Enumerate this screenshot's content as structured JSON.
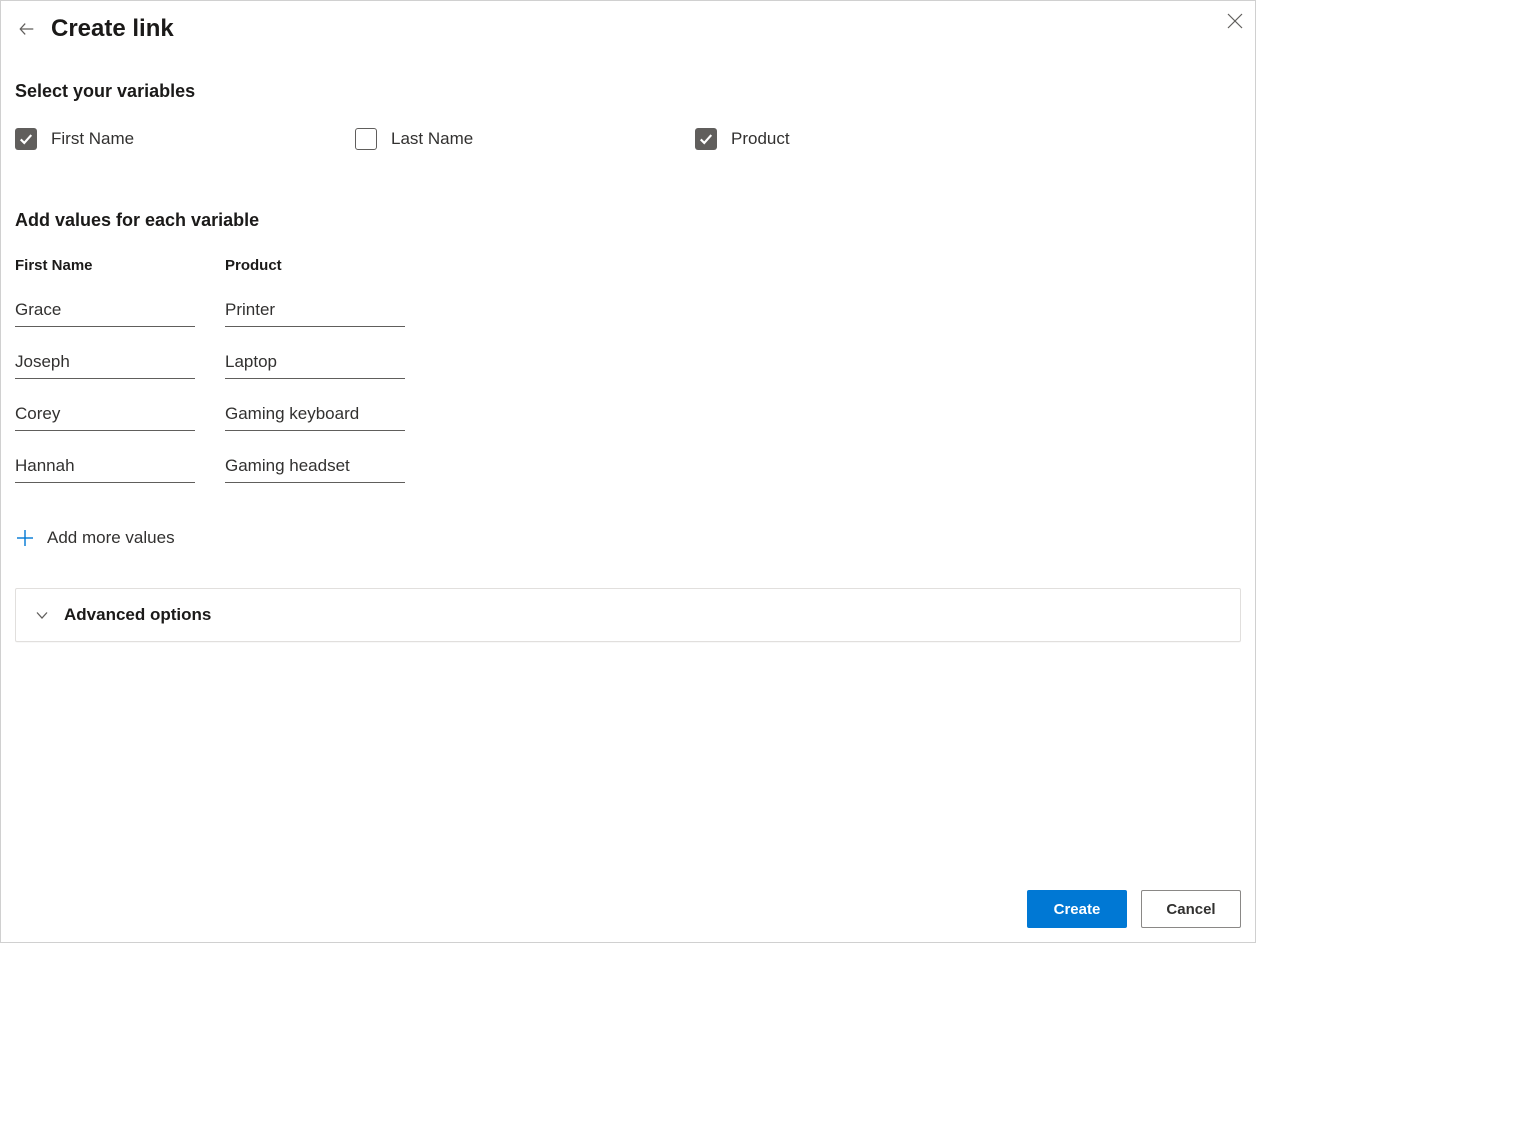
{
  "header": {
    "title": "Create link"
  },
  "sections": {
    "selectVars": "Select your variables",
    "addValues": "Add values for each variable"
  },
  "variables": [
    {
      "label": "First Name",
      "checked": true
    },
    {
      "label": "Last Name",
      "checked": false
    },
    {
      "label": "Product",
      "checked": true
    }
  ],
  "columns": {
    "firstName": "First Name",
    "product": "Product"
  },
  "rows": [
    {
      "firstName": "Grace",
      "product": "Printer"
    },
    {
      "firstName": "Joseph",
      "product": "Laptop"
    },
    {
      "firstName": "Corey",
      "product": "Gaming keyboard"
    },
    {
      "firstName": "Hannah",
      "product": "Gaming headset"
    }
  ],
  "addMore": "Add more values",
  "advanced": "Advanced options",
  "footer": {
    "create": "Create",
    "cancel": "Cancel"
  }
}
